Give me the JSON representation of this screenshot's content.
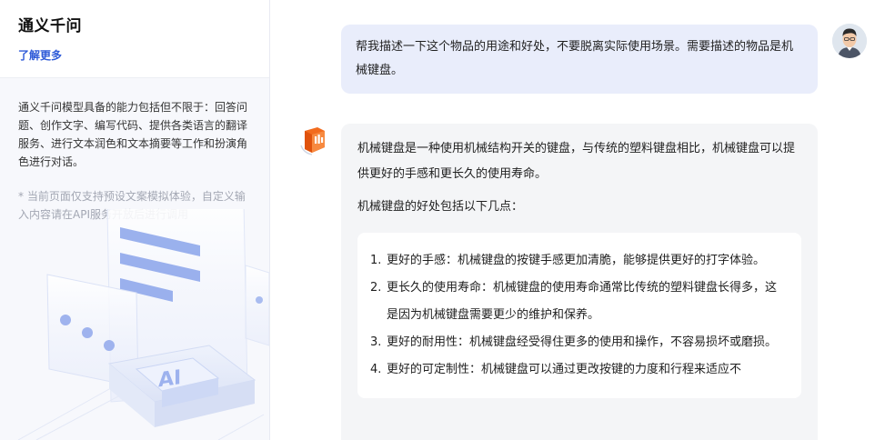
{
  "sidebar": {
    "title": "通义千问",
    "learn_more": "了解更多",
    "intro": "通义千问模型具备的能力包括但不限于：回答问题、创作文字、编写代码、提供各类语言的翻译服务、进行文本润色和文本摘要等工作和扮演角色进行对话。",
    "notice": "* 当前页面仅支持预设文案模拟体验，自定义输入内容请在API服务开放后进行调用",
    "illustration_text": "AI"
  },
  "chat": {
    "user_message": "帮我描述一下这个物品的用途和好处，不要脱离实际使用场景。需要描述的物品是机械键盘。",
    "bot_message": {
      "paragraph_1": "机械键盘是一种使用机械结构开关的键盘，与传统的塑料键盘相比，机械键盘可以提供更好的手感和更长久的使用寿命。",
      "paragraph_2": "机械键盘的好处包括以下几点：",
      "list": [
        {
          "num": "1.",
          "text": "更好的手感：机械键盘的按键手感更加清脆，能够提供更好的打字体验。"
        },
        {
          "num": "2.",
          "text": "更长久的使用寿命：机械键盘的使用寿命通常比传统的塑料键盘长得多，这是因为机械键盘需要更少的维护和保养。"
        },
        {
          "num": "3.",
          "text": "更好的耐用性：机械键盘经受得住更多的使用和操作，不容易损坏或磨损。"
        },
        {
          "num": "4.",
          "text": "更好的可定制性：机械键盘可以通过更改按键的力度和行程来适应不"
        }
      ]
    }
  },
  "colors": {
    "accent": "#2f5bd8",
    "user_bubble": "#e9edfb",
    "bot_bubble": "#f4f5f7",
    "bot_logo": "#f26b1d"
  },
  "icons": {
    "user_avatar": "user-avatar-icon",
    "bot_avatar": "qwen-logo-icon"
  }
}
